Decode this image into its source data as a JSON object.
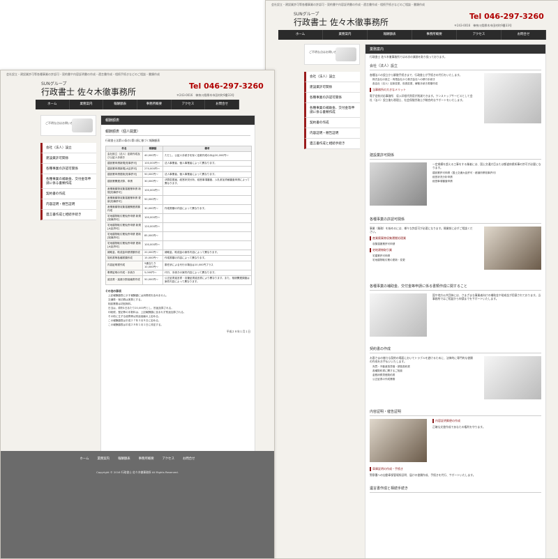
{
  "site": {
    "top_note": "会社設立・建設業許可等各種事業の許認可・契約書や内容証明書の作成・遺言書作成・相続手続きなどのご相談・書類作成",
    "brand_sub": "SUNグループ",
    "brand": "行政書士 佐々木徹事務所",
    "tel": "Tel 046-297-3260",
    "address": "〒243-0016　神奈川県厚木市田村町9番33号"
  },
  "nav": [
    "ホーム",
    "業務案内",
    "報酬額表",
    "事務所概要",
    "アクセス",
    "お問合せ"
  ],
  "sidebar": {
    "banner_text": "ご不明な点はお問い合わせ下さい",
    "items": [
      "会社（法人）設立",
      "建設業許可関係",
      "各種事業の許認可関係",
      "各種事業の補助金、交付金等申請に係る書類作成",
      "契約書の作成",
      "内容証明・催告証明",
      "遺言書作成と相続手続き"
    ]
  },
  "services_page": {
    "panel_title": "業務案内",
    "intro": "行政書士 佐々木徹事務所ではの次の業務を取り扱っております。",
    "sections": [
      {
        "title": "会社（法人）設立",
        "text": "各種法人の設立から解散手続きまで、行政書士が手続きの代行をいたします。",
        "bullets": [
          "株式会社の設立・有限会社から株式会社への移行手続き",
          "各会社（法人）定款変更、役員変更、解散手続き書類作成"
        ],
        "sub": "当事務所の大きなメリット",
        "sub_text": "電子定款対応事務所　収入印紙代費用が削減できます。ワンストップサービスとして会社（法人）設立後も税理士、社会保険労務士が総合的なサポートをいたします。"
      },
      {
        "title": "建設業許可関係",
        "text": "一定規模を超える工事をする業者には、国土交通大臣または都道府県知事の許可が必要になります。",
        "bullets": [
          "建設業許可申請（国土交通大臣許可・都道府県知事許可）",
          "経営状況分析申請",
          "経営事項審査申請"
        ]
      },
      {
        "title": "各種事業の許認可関係",
        "text": "事業（業務）を始めるには、様々な許認可が必要になります。開業前に必ずご相談ください。",
        "sub": "産業廃棄物収集運搬処理業",
        "bullets": [
          "収集運搬業許可申請"
        ],
        "sub2": "宅地建物取引業",
        "bullets2": [
          "宅建業許可申請",
          "宅地建物取引業の更新・変更"
        ]
      },
      {
        "title": "各種事業の補助金、交付金等申請に係る書類作成に関すること",
        "text": "国や地方公共団体には、さまざまな事業者向けの補助金や助成金が用意されております。当事務所ではご相談から申請までをサポートいたします。"
      },
      {
        "title": "契約書の作成",
        "text": "お客さまの様々な契約の場面においてトラブルを避けるために、法律的に専門的な書類の作成をお手伝いいたします。",
        "bullets": [
          "売買・不動産賃貸借・請負契約書",
          "各種契約書に関するご相談",
          "金銭消費貸借契約書",
          "公正証書の作成業務"
        ]
      },
      {
        "title": "内容証明・催告証明",
        "sub": "内容証明郵便の作成",
        "text": "正確な文書作成であなたの権利を守ります。",
        "sub2": "車庫証明の作成・手続き",
        "text2": "警察署への自動車保管場所証明、届けの書類作成、手続きを代行、サポートいたします。"
      },
      {
        "title": "遺言書作成と相続手続き"
      }
    ]
  },
  "fees_page": {
    "panel_title": "報酬額表",
    "table_title": "報酬額表（個人開業）",
    "note": "行政書士法第10条の2第1項に基づく報酬額表",
    "headers": [
      "件名",
      "報酬額",
      "備考"
    ],
    "rows": [
      [
        "会社設立（法人）定款作成及び公証人手続き",
        "40,000円〜",
        "ただし、公証人手続きを除く定款作成のみは20,000円〜"
      ],
      [
        "建設業申請新規[知事許可]",
        "100,000円〜",
        "法人事業者、個人事業者によって異なります。"
      ],
      [
        "建設業申請新規[大臣許可]",
        "270,000円〜",
        ""
      ],
      [
        "建設業申請更新[知事許可]",
        "50,000円〜",
        "法人事業者、個人事業者によって異なります。"
      ],
      [
        "建設業関連決算、申請",
        "30,000円〜",
        "決算変更届、経営状況分析、経営事項審査、入札参加資格審査申請によって異なります。"
      ],
      [
        "産業廃棄物収集運搬業申請 新規[知事許可]",
        "100,000円〜",
        ""
      ],
      [
        "産業廃棄物収集運搬業申請 更新[知事許可]",
        "50,000円〜",
        ""
      ],
      [
        "産業廃棄物収集運搬関連書類作成",
        "30,000円〜",
        "作成書類の内容によって異なります。"
      ],
      [
        "宅地建物取引業免許申請 新規[知事許可]",
        "100,000円〜",
        ""
      ],
      [
        "宅地建物取引業免許申請 新規[大臣許可]",
        "120,000円〜",
        ""
      ],
      [
        "宅地建物取引業免許申請 更新[知事許可]",
        "85,000円〜",
        ""
      ],
      [
        "宅地建物取引業免許申請 更新[大臣許可]",
        "100,000円〜",
        ""
      ],
      [
        "補助金、助成金申請書類作成",
        "20,000円〜",
        "補助金、助成金の案件内容によって異なります。"
      ],
      [
        "契約書等各種書類作成",
        "15,000円〜",
        "作成書類の内容によって異なります。"
      ],
      [
        "内容証明書作成",
        "5通当たり10,000円〜",
        "委任状による代行の場合は10,000円プラス"
      ],
      [
        "車庫証明の作成・手続き",
        "5,000円〜",
        "代行、手続きの案件内容によって異なります。"
      ],
      [
        "遺言書・遺産分割協議書作成",
        "50,000円〜",
        "公正証書遺言書・自筆証書遺言書により異なります。また、相続関連調査は案件内容によって異なります。"
      ]
    ],
    "notes_title": "その他の事項",
    "notes": [
      "上記報酬額表に示す報酬額には消費税を含みません。",
      "交通費・宿泊費は実費とする。",
      "相談業務は初回無料。",
      "日当は、原則1日あたり20,000円とし、別途加算される。",
      "印紙税、登記等の手数料は、上記報酬額に含まれず別途加算される。",
      "その他に生ずる経費等は別途協議の上定める。",
      "この報酬額表は平成２７年３月９日に定める。",
      "この報酬額表は平成２８年１月１日に改定する。"
    ],
    "date": "平成２８年１月１日"
  },
  "footer": {
    "nav": [
      "ホーム",
      "業務案内",
      "報酬額表",
      "事務所概要",
      "アクセス",
      "お問合せ"
    ],
    "copyright": "Copyright © 2016 行政書士 佐々木徹事務所 All Rights Reserved."
  }
}
